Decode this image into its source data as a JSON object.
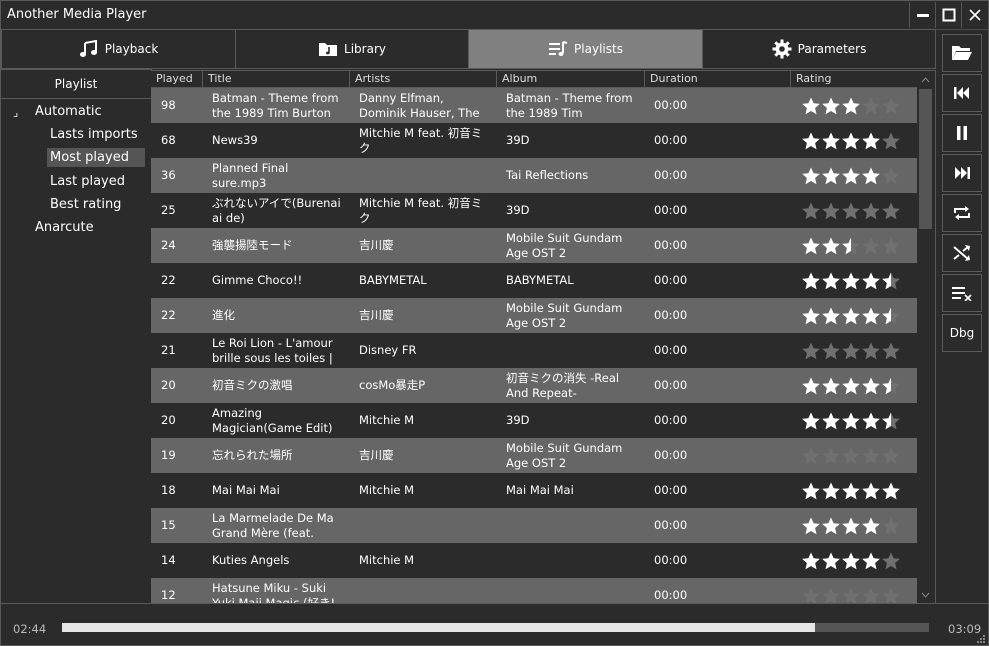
{
  "window": {
    "title": "Another Media Player"
  },
  "tabs": [
    {
      "label": "Playback",
      "icon": "music-note-icon",
      "active": false
    },
    {
      "label": "Library",
      "icon": "folder-music-icon",
      "active": false
    },
    {
      "label": "Playlists",
      "icon": "playlist-icon",
      "active": true
    },
    {
      "label": "Parameters",
      "icon": "gear-icon",
      "active": false
    }
  ],
  "sidebar": {
    "header": "Playlist",
    "items": [
      {
        "label": "Automatic",
        "level": 0,
        "expander": "⌟"
      },
      {
        "label": "Lasts imports",
        "level": 1
      },
      {
        "label": "Most played",
        "level": 1,
        "selected": true
      },
      {
        "label": "Last played",
        "level": 1
      },
      {
        "label": "Best rating",
        "level": 1
      },
      {
        "label": "Anarcute",
        "level": 0
      }
    ]
  },
  "table": {
    "columns": [
      "Played",
      "Title",
      "Artists",
      "Album",
      "Duration",
      "Rating"
    ],
    "rows": [
      {
        "played": "98",
        "title": "Batman - Theme from the 1989 Tim Burton",
        "artists": "Danny Elfman, Dominik Hauser, The City Of",
        "album": "Batman - Theme from the 1989 Tim",
        "duration": "00:00",
        "rating": 3
      },
      {
        "played": "68",
        "title": "News39",
        "artists": "Mitchie M feat. 初音ミク",
        "album": "39D",
        "duration": "00:00",
        "rating": 4
      },
      {
        "played": "36",
        "title": "Planned Final sure.mp3",
        "artists": "",
        "album": "Tai Reflections",
        "duration": "00:00",
        "rating": 4
      },
      {
        "played": "25",
        "title": "ぶれないアイで(Burenai ai de)",
        "artists": "Mitchie M feat. 初音ミク",
        "album": "39D",
        "duration": "00:00",
        "rating": 0
      },
      {
        "played": "24",
        "title": "強襲揚陸モード",
        "artists": "吉川慶",
        "album": "Mobile Suit Gundam Age OST 2",
        "duration": "00:00",
        "rating": 2.5
      },
      {
        "played": "22",
        "title": "Gimme Choco!!",
        "artists": "BABYMETAL",
        "album": "BABYMETAL",
        "duration": "00:00",
        "rating": 4.5
      },
      {
        "played": "22",
        "title": "進化",
        "artists": "吉川慶",
        "album": "Mobile Suit Gundam Age OST 2",
        "duration": "00:00",
        "rating": 4.5
      },
      {
        "played": "21",
        "title": "Le Roi Lion - L'amour brille sous les toiles |",
        "artists": "Disney FR",
        "album": "",
        "duration": "00:00",
        "rating": 0
      },
      {
        "played": "20",
        "title": "初音ミクの激唱",
        "artists": "cosMo暴走P",
        "album": "初音ミクの消失 -Real And Repeat-",
        "duration": "00:00",
        "rating": 4.5
      },
      {
        "played": "20",
        "title": "Amazing Magician(Game Edit)",
        "artists": "Mitchie M",
        "album": "39D",
        "duration": "00:00",
        "rating": 4.5
      },
      {
        "played": "19",
        "title": "忘れられた場所",
        "artists": "吉川慶",
        "album": "Mobile Suit Gundam Age OST 2",
        "duration": "00:00",
        "rating": 0
      },
      {
        "played": "18",
        "title": "Mai Mai Mai",
        "artists": "Mitchie M",
        "album": "Mai Mai Mai",
        "duration": "00:00",
        "rating": 5
      },
      {
        "played": "15",
        "title": "La Marmelade De Ma Grand Mère (feat.",
        "artists": "",
        "album": "",
        "duration": "00:00",
        "rating": 4
      },
      {
        "played": "14",
        "title": "Kuties Angels",
        "artists": "Mitchie M",
        "album": "",
        "duration": "00:00",
        "rating": 4
      },
      {
        "played": "12",
        "title": "Hatsune Miku - Suki Yuki Maji Magic (好き!雪!",
        "artists": "",
        "album": "",
        "duration": "00:00",
        "rating": 0
      }
    ]
  },
  "controls": [
    {
      "name": "open-folder-button",
      "icon": "folder-open-icon"
    },
    {
      "name": "previous-button",
      "icon": "skip-previous-icon"
    },
    {
      "name": "pause-button",
      "icon": "pause-icon"
    },
    {
      "name": "next-button",
      "icon": "skip-next-icon"
    },
    {
      "name": "repeat-button",
      "icon": "repeat-icon"
    },
    {
      "name": "shuffle-button",
      "icon": "shuffle-icon"
    },
    {
      "name": "clear-queue-button",
      "icon": "clear-list-icon"
    },
    {
      "name": "debug-button",
      "label": "Dbg"
    }
  ],
  "player": {
    "elapsed": "02:44",
    "total": "03:09",
    "progress": 0.868
  },
  "colors": {
    "background": "#2b2b2b",
    "row_alt": "#666666",
    "active_tab": "#808080",
    "star_on": "#ffffff",
    "star_off": "#707070"
  }
}
